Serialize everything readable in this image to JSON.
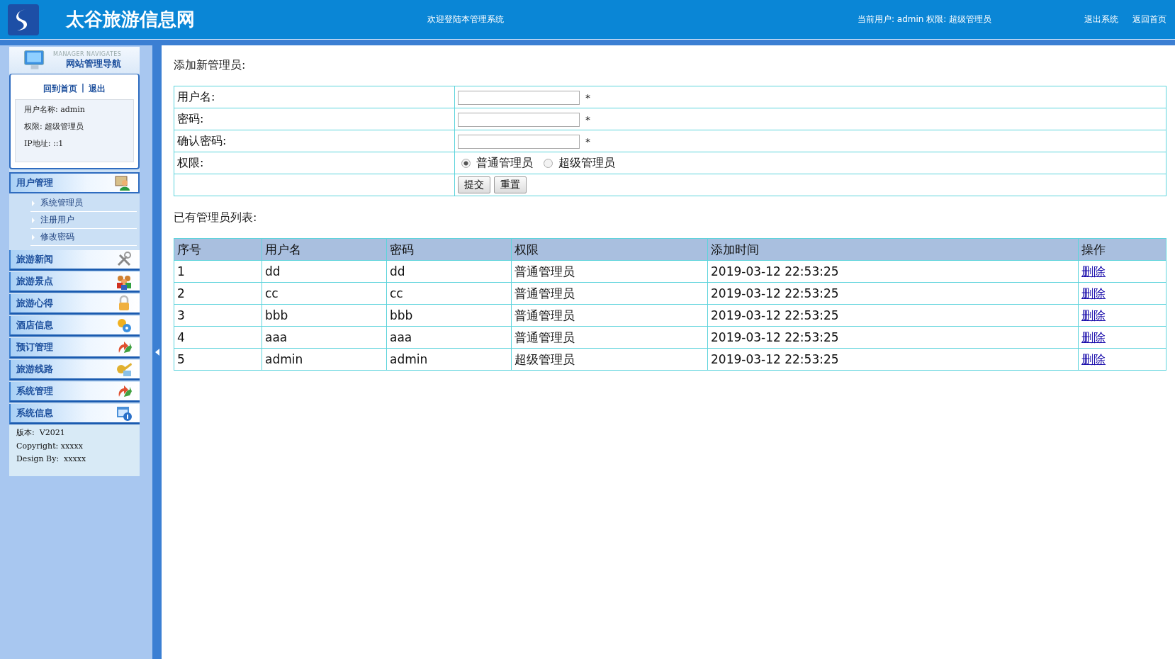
{
  "header": {
    "site_title": "太谷旅游信息网",
    "welcome": "欢迎登陆本管理系统",
    "current_user": "当前用户: admin 权限: 超级管理员",
    "links": [
      "退出系统",
      "返回首页"
    ]
  },
  "sidebar": {
    "subtitle": "MANAGER NAVIGATES",
    "title": "网站管理导航",
    "links": [
      "回到首页",
      "退出"
    ],
    "separator": "|",
    "info": [
      "用户名称: admin",
      "权限: 超级管理员",
      "IP地址: ::1"
    ],
    "groups": [
      {
        "label": "用户管理",
        "kind": "person",
        "expanded": true,
        "children": [
          "系统管理员",
          "注册用户",
          "修改密码"
        ]
      },
      {
        "label": "旅游新闻",
        "kind": "tools",
        "expanded": false
      },
      {
        "label": "旅游景点",
        "kind": "people",
        "expanded": false
      },
      {
        "label": "旅游心得",
        "kind": "lock",
        "expanded": false
      },
      {
        "label": "酒店信息",
        "kind": "gears",
        "expanded": false
      },
      {
        "label": "预订管理",
        "kind": "arrows",
        "expanded": false
      },
      {
        "label": "旅游线路",
        "kind": "key",
        "expanded": false
      },
      {
        "label": "系统管理",
        "kind": "arrows",
        "expanded": false
      },
      {
        "label": "系统信息",
        "kind": "info",
        "expanded": false
      }
    ],
    "footer": [
      "版本:  V2021",
      "Copyright: xxxxx",
      "Design By:  xxxxx"
    ]
  },
  "form": {
    "title": "添加新管理员:",
    "rows": [
      {
        "kind": "input",
        "label": "用户名:",
        "required": "*"
      },
      {
        "kind": "input",
        "label": "密码:",
        "required": "*"
      },
      {
        "kind": "input",
        "label": "确认密码:",
        "required": "*"
      },
      {
        "kind": "radio",
        "label": "权限:",
        "options": [
          {
            "label": "普通管理员",
            "selected": true
          },
          {
            "label": "超级管理员",
            "selected": false
          }
        ]
      },
      {
        "kind": "buttons",
        "buttons": [
          "提交",
          "重置"
        ]
      }
    ]
  },
  "table": {
    "title": "已有管理员列表:",
    "columns": [
      "序号",
      "用户名",
      "密码",
      "权限",
      "添加时间",
      "操作"
    ],
    "rows": [
      [
        "1",
        "dd",
        "dd",
        "普通管理员",
        "2019-03-12 22:53:25",
        "删除"
      ],
      [
        "2",
        "cc",
        "cc",
        "普通管理员",
        "2019-03-12 22:53:25",
        "删除"
      ],
      [
        "3",
        "bbb",
        "bbb",
        "普通管理员",
        "2019-03-12 22:53:25",
        "删除"
      ],
      [
        "4",
        "aaa",
        "aaa",
        "普通管理员",
        "2019-03-12 22:53:25",
        "删除"
      ],
      [
        "5",
        "admin",
        "admin",
        "超级管理员",
        "2019-03-12 22:53:25",
        "删除"
      ]
    ]
  }
}
